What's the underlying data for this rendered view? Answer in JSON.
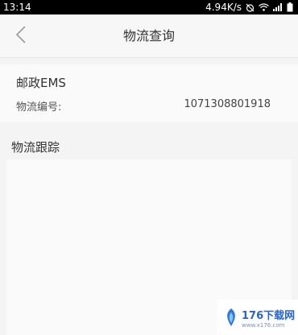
{
  "status_bar": {
    "time": "13:14",
    "network_speed": "4.94K/s"
  },
  "header": {
    "title": "物流查询"
  },
  "shipment": {
    "carrier": "邮政EMS",
    "tracking_label": "物流编号:",
    "tracking_number": "1071308801918"
  },
  "tracking": {
    "section_title": "物流跟踪"
  },
  "watermark": {
    "text": "176下载网",
    "sub": "www.x176.com"
  },
  "colors": {
    "background": "#f4f4f4",
    "status_bar": "#000000",
    "text_primary": "#333333"
  }
}
